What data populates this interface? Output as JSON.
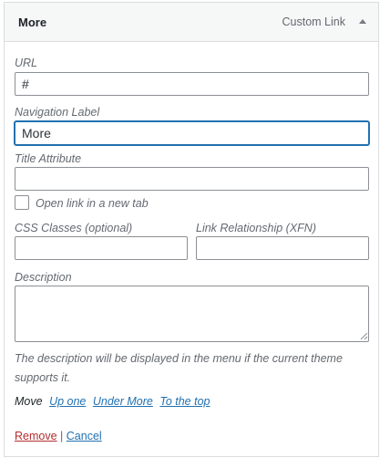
{
  "header": {
    "title": "More",
    "item_type": "Custom Link"
  },
  "url": {
    "label": "URL",
    "value": "#"
  },
  "navigation_label": {
    "label": "Navigation Label",
    "value": "More"
  },
  "title_attribute": {
    "label": "Title Attribute",
    "value": ""
  },
  "open_new_tab": {
    "label": "Open link in a new tab",
    "checked": false
  },
  "css_classes": {
    "label": "CSS Classes (optional)",
    "value": ""
  },
  "link_relationship": {
    "label": "Link Relationship (XFN)",
    "value": ""
  },
  "description": {
    "label": "Description",
    "value": "",
    "note": "The description will be displayed in the menu if the current theme supports it."
  },
  "move": {
    "label": "Move",
    "up_one": "Up one",
    "under_more": "Under More",
    "to_the_top": "To the top"
  },
  "actions": {
    "remove": "Remove",
    "separator": "|",
    "cancel": "Cancel"
  },
  "icons": {
    "toggle": "arrow-up-icon"
  },
  "colors": {
    "link": "#2271b1",
    "remove": "#b32d2e",
    "focus": "#2271b1"
  }
}
